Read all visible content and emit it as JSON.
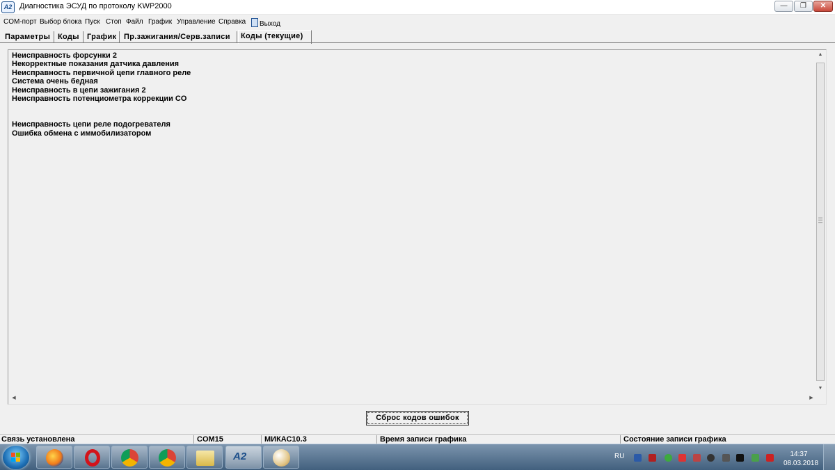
{
  "window": {
    "app_icon_text": "A2",
    "title": "Диагностика ЭСУД по протоколу KWP2000"
  },
  "menu": {
    "items": [
      "COM-порт",
      "Выбор блока",
      "Пуск",
      "Стоп",
      "Файл",
      "График",
      "Управление",
      "Справка",
      "Выход"
    ]
  },
  "tabs": {
    "items": [
      "Параметры",
      "Коды",
      "График",
      "Пр.зажигания/Серв.записи",
      "Коды (текущие)"
    ],
    "active": "Коды (текущие)"
  },
  "codes": {
    "lines": [
      "Неисправность форсунки 2",
      "Некорректные показания датчика давления",
      "Неисправность первичной цепи главного реле",
      "Система очень бедная",
      "Неисправность в цепи зажигания 2",
      "Неисправность потенциометра коррекции CO",
      "",
      "",
      "Неисправность цепи реле подогревателя",
      "Ошибка обмена с иммобилизатором"
    ]
  },
  "reset_button": {
    "label": "Сброс кодов ошибок"
  },
  "status": {
    "connection": "Связь установлена",
    "port": "COM15",
    "ecu": "МИКАС10.3",
    "graph_time_label": "Время записи графика",
    "graph_state_label": "Состояние записи графика"
  },
  "taskbar": {
    "apps": [
      "firefox",
      "opera",
      "chrome",
      "chrome-user",
      "file-manager",
      "a2-diagnostics",
      "paint"
    ],
    "a2_label": "A2",
    "language": "RU",
    "time": "14:37",
    "date": "08.03.2018"
  },
  "colors": {
    "window_bg": "#f0f0f0",
    "taskbar": "#42607e",
    "close_button": "#c9483a"
  }
}
